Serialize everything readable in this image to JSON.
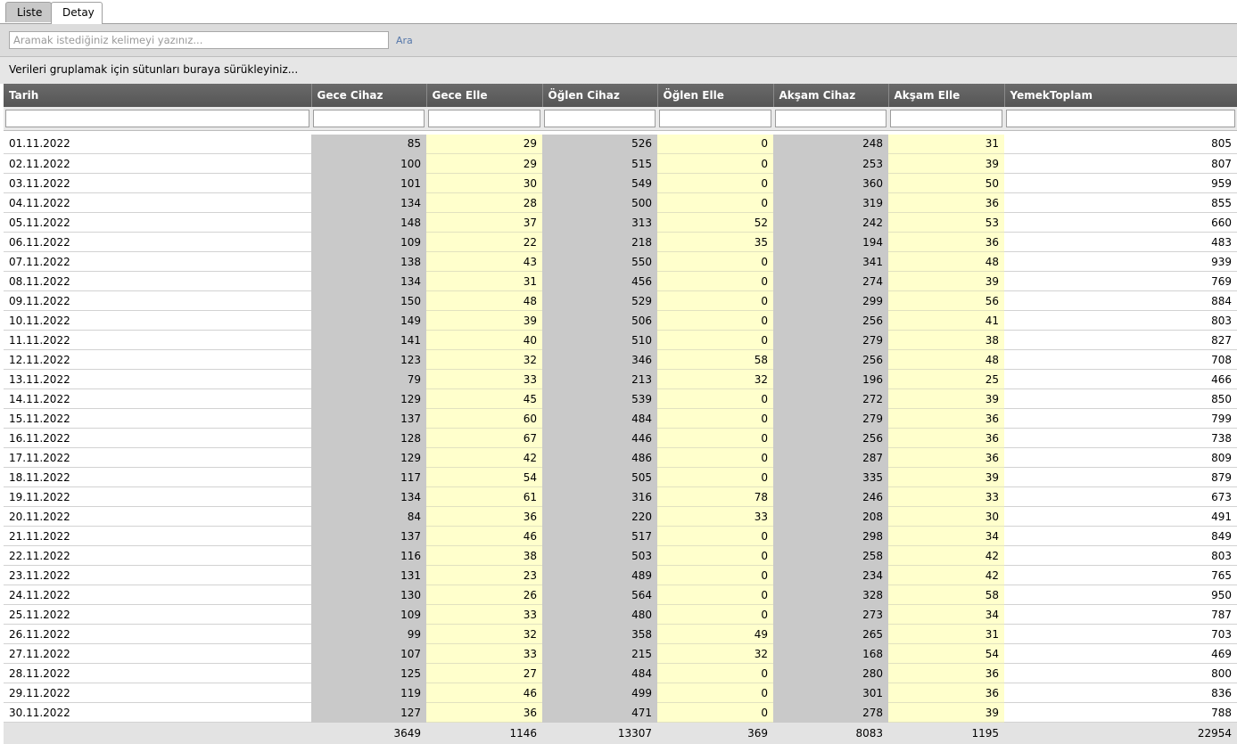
{
  "tabs": [
    {
      "label": "Liste",
      "active": false
    },
    {
      "label": "Detay",
      "active": true
    }
  ],
  "search": {
    "placeholder": "Aramak istediğiniz kelimeyi yazınız...",
    "value": "",
    "button_label": "Ara"
  },
  "group_panel": {
    "text": "Verileri gruplamak için sütunları buraya sürükleyiniz..."
  },
  "table": {
    "columns": [
      "Tarih",
      "Gece Cihaz",
      "Gece Elle",
      "Öğlen Cihaz",
      "Öğlen Elle",
      "Akşam Cihaz",
      "Akşam Elle",
      "YemekToplam"
    ],
    "rows": [
      [
        "01.11.2022",
        "85",
        "29",
        "526",
        "0",
        "248",
        "31",
        "805"
      ],
      [
        "02.11.2022",
        "100",
        "29",
        "515",
        "0",
        "253",
        "39",
        "807"
      ],
      [
        "03.11.2022",
        "101",
        "30",
        "549",
        "0",
        "360",
        "50",
        "959"
      ],
      [
        "04.11.2022",
        "134",
        "28",
        "500",
        "0",
        "319",
        "36",
        "855"
      ],
      [
        "05.11.2022",
        "148",
        "37",
        "313",
        "52",
        "242",
        "53",
        "660"
      ],
      [
        "06.11.2022",
        "109",
        "22",
        "218",
        "35",
        "194",
        "36",
        "483"
      ],
      [
        "07.11.2022",
        "138",
        "43",
        "550",
        "0",
        "341",
        "48",
        "939"
      ],
      [
        "08.11.2022",
        "134",
        "31",
        "456",
        "0",
        "274",
        "39",
        "769"
      ],
      [
        "09.11.2022",
        "150",
        "48",
        "529",
        "0",
        "299",
        "56",
        "884"
      ],
      [
        "10.11.2022",
        "149",
        "39",
        "506",
        "0",
        "256",
        "41",
        "803"
      ],
      [
        "11.11.2022",
        "141",
        "40",
        "510",
        "0",
        "279",
        "38",
        "827"
      ],
      [
        "12.11.2022",
        "123",
        "32",
        "346",
        "58",
        "256",
        "48",
        "708"
      ],
      [
        "13.11.2022",
        "79",
        "33",
        "213",
        "32",
        "196",
        "25",
        "466"
      ],
      [
        "14.11.2022",
        "129",
        "45",
        "539",
        "0",
        "272",
        "39",
        "850"
      ],
      [
        "15.11.2022",
        "137",
        "60",
        "484",
        "0",
        "279",
        "36",
        "799"
      ],
      [
        "16.11.2022",
        "128",
        "67",
        "446",
        "0",
        "256",
        "36",
        "738"
      ],
      [
        "17.11.2022",
        "129",
        "42",
        "486",
        "0",
        "287",
        "36",
        "809"
      ],
      [
        "18.11.2022",
        "117",
        "54",
        "505",
        "0",
        "335",
        "39",
        "879"
      ],
      [
        "19.11.2022",
        "134",
        "61",
        "316",
        "78",
        "246",
        "33",
        "673"
      ],
      [
        "20.11.2022",
        "84",
        "36",
        "220",
        "33",
        "208",
        "30",
        "491"
      ],
      [
        "21.11.2022",
        "137",
        "46",
        "517",
        "0",
        "298",
        "34",
        "849"
      ],
      [
        "22.11.2022",
        "116",
        "38",
        "503",
        "0",
        "258",
        "42",
        "803"
      ],
      [
        "23.11.2022",
        "131",
        "23",
        "489",
        "0",
        "234",
        "42",
        "765"
      ],
      [
        "24.11.2022",
        "130",
        "26",
        "564",
        "0",
        "328",
        "58",
        "950"
      ],
      [
        "25.11.2022",
        "109",
        "33",
        "480",
        "0",
        "273",
        "34",
        "787"
      ],
      [
        "26.11.2022",
        "99",
        "32",
        "358",
        "49",
        "265",
        "31",
        "703"
      ],
      [
        "27.11.2022",
        "107",
        "33",
        "215",
        "32",
        "168",
        "54",
        "469"
      ],
      [
        "28.11.2022",
        "125",
        "27",
        "484",
        "0",
        "280",
        "36",
        "800"
      ],
      [
        "29.11.2022",
        "119",
        "46",
        "499",
        "0",
        "301",
        "36",
        "836"
      ],
      [
        "30.11.2022",
        "127",
        "36",
        "471",
        "0",
        "278",
        "39",
        "788"
      ]
    ],
    "totals": [
      "",
      "3649",
      "1146",
      "13307",
      "369",
      "8083",
      "1195",
      "22954"
    ]
  },
  "colors": {
    "header_bg": "#5e5e5e",
    "device_column_bg": "#c9c9c9",
    "manual_column_bg": "#ffffcc",
    "footer_bg": "#e3e3e3"
  }
}
